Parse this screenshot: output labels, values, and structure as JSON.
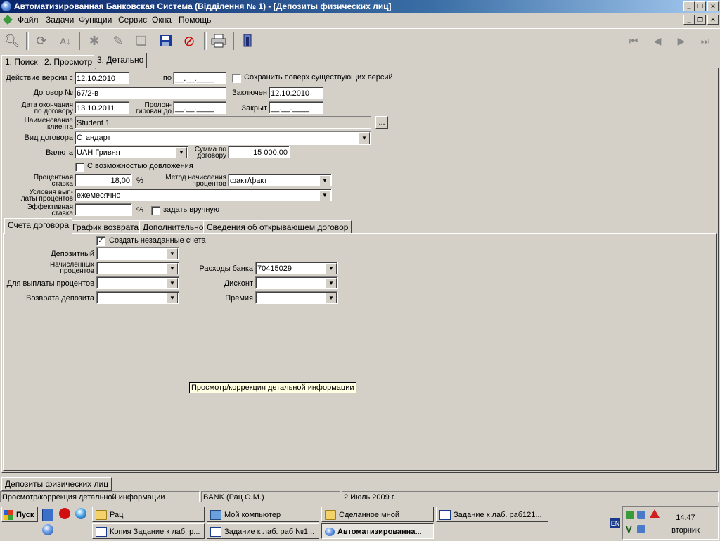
{
  "window": {
    "title": "Автоматизированная Банковская Система (Відділення № 1) - [Депозиты физических лиц]"
  },
  "menu": [
    "Файл",
    "Задачи",
    "Функции",
    "Сервис",
    "Окна",
    "Помощь"
  ],
  "tabs": [
    "1. Поиск",
    "2. Просмотр",
    "3. Детально"
  ],
  "form": {
    "version_from_label": "Действие версии с",
    "version_from": "12.10.2010",
    "version_to_label": "по",
    "version_to": "__.__.____",
    "keep_versions_label": "Сохранить поверх существующих версий",
    "keep_versions_checked": false,
    "contract_no_label": "Договор №",
    "contract_no": "67/2-в",
    "concluded_label": "Заключен",
    "concluded": "12.10.2010",
    "end_date_label_1": "Дата окончания",
    "end_date_label_2": "по договору",
    "end_date": "13.10.2011",
    "prolong_label_1": "Пролон-",
    "prolong_label_2": "гирован до",
    "prolong_date": "__.__.____",
    "closed_label": "Закрыт",
    "closed_date": "__.__.____",
    "client_label_1": "Наименование",
    "client_label_2": "клиента",
    "client_name": "Student 1",
    "ellipsis": "...",
    "contract_type_label": "Вид договора",
    "contract_type": "Стандарт",
    "currency_label": "Валюта",
    "currency": "UAH Гривня",
    "amount_label_1": "Сумма по",
    "amount_label_2": "договору",
    "amount": "15 000,00",
    "topup_label": "С возможностью довложения",
    "topup_checked": false,
    "rate_label_1": "Процентная",
    "rate_label_2": "ставка",
    "rate": "18,00",
    "percent_sign": "%",
    "calc_method_label_1": "Метод начисления",
    "calc_method_label_2": "процентов",
    "calc_method": "факт/факт",
    "payout_label_1": "Условия вып-",
    "payout_label_2": "латы процентов",
    "payout": "ежемесячно",
    "eff_rate_label_1": "Эффективная",
    "eff_rate_label_2": "ставка",
    "eff_rate": "",
    "manual_label": "задать вручную",
    "manual_checked": false
  },
  "subtabs": [
    "Счета договора",
    "График возврата",
    "Дополнительно",
    "Сведения об открывающем договор"
  ],
  "accounts": {
    "create_label": "Создать незаданные счета",
    "create_checked": true,
    "deposit_label": "Депозитный",
    "accrued_label_1": "Начисленных",
    "accrued_label_2": "процентов",
    "payout_label": "Для выплаты процентов",
    "return_label": "Возврата депозита",
    "bank_exp_label": "Расходы банка",
    "bank_exp_value": "70415029",
    "discount_label": "Дисконт",
    "premium_label": "Премия"
  },
  "tooltip": "Просмотр/коррекция детальной информации",
  "window_tab": "Депозиты физических лиц",
  "status": {
    "left": "Просмотр/коррекция детальной информации",
    "mid": "BANK (Рац О.М.)",
    "right": "2 Июль 2009 г."
  },
  "taskbar": {
    "start": "Пуск",
    "row1": [
      "Рац",
      "Мой компьютер",
      "Сделанное мной",
      "Задание к лаб. раб121..."
    ],
    "row2": [
      "Копия Задание к лаб. р...",
      "Задание к лаб. раб №1...",
      "Автоматизированна..."
    ],
    "lang": "EN",
    "time": "14:47",
    "day": "вторник"
  },
  "colors": {
    "face": "#d4d0c8",
    "title_start": "#0a246a",
    "title_end": "#a6caf0",
    "tooltip_bg": "#ffffe1"
  }
}
